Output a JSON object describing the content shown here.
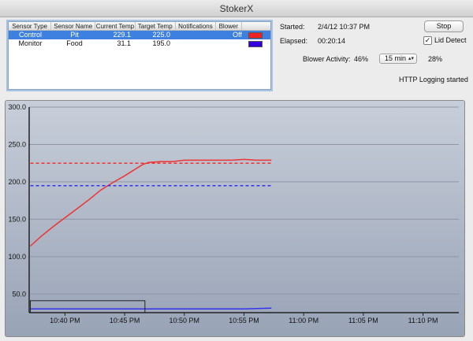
{
  "window": {
    "title": "StokerX"
  },
  "table": {
    "headers": [
      "Sensor Type",
      "Sensor Name",
      "Current Temp",
      "Target Temp",
      "Notifications",
      "Blower"
    ],
    "rows": [
      {
        "type": "Control",
        "name": "Pit",
        "current": "229.1",
        "target": "225.0",
        "notifications": "",
        "blower": "Off",
        "color": "#ee2222",
        "selected": true
      },
      {
        "type": "Monitor",
        "name": "Food",
        "current": "31.1",
        "target": "195.0",
        "notifications": "",
        "blower": "",
        "color": "#3300dd",
        "selected": false
      }
    ]
  },
  "info": {
    "started_label": "Started:",
    "started_value": "2/4/12 10:37 PM",
    "elapsed_label": "Elapsed:",
    "elapsed_value": "00:20:14",
    "stop_label": "Stop",
    "lid_detect_label": "Lid Detect",
    "lid_detect_checked": true,
    "blower_label": "Blower Activity:",
    "blower_value": "46%",
    "interval_value": "15 min",
    "interval_activity": "28%",
    "status": "HTTP Logging started"
  },
  "chart_data": {
    "type": "line",
    "x_ticks": [
      "10:40 PM",
      "10:45 PM",
      "10:50 PM",
      "10:55 PM",
      "11:00 PM",
      "11:05 PM",
      "11:10 PM"
    ],
    "x_tick_minutes": [
      40,
      45,
      50,
      55,
      60,
      65,
      70
    ],
    "xlim_minutes": [
      37,
      73
    ],
    "y_ticks": [
      "50.0",
      "100.0",
      "150.0",
      "200.0",
      "250.0",
      "300.0"
    ],
    "ylim": [
      25,
      300
    ],
    "series": [
      {
        "color": "#ee3333",
        "x": [
          37.1,
          38,
          39,
          40,
          41,
          42,
          43,
          44,
          45,
          46,
          46.5,
          47,
          48,
          49,
          50,
          51,
          52,
          53,
          54,
          55,
          56,
          57.3
        ],
        "y": [
          114,
          127,
          140,
          152,
          164,
          176,
          189,
          199,
          208,
          218,
          223,
          226,
          227,
          227,
          229,
          229,
          229,
          229,
          229,
          230,
          229,
          229
        ]
      },
      {
        "color": "#3333ee",
        "x": [
          37.1,
          40,
          45,
          50,
          55,
          57.3
        ],
        "y": [
          30,
          30,
          30,
          30,
          30,
          31
        ]
      },
      {
        "color": "#ee3333",
        "dashed": true,
        "x": [
          37.1,
          57.3
        ],
        "y": [
          225,
          225
        ]
      },
      {
        "color": "#3333ee",
        "dashed": true,
        "x": [
          37.1,
          57.3
        ],
        "y": [
          195,
          195
        ]
      }
    ],
    "selection_box": {
      "x": [
        37.1,
        46.7
      ],
      "y": [
        25,
        41
      ]
    },
    "grid": true
  }
}
